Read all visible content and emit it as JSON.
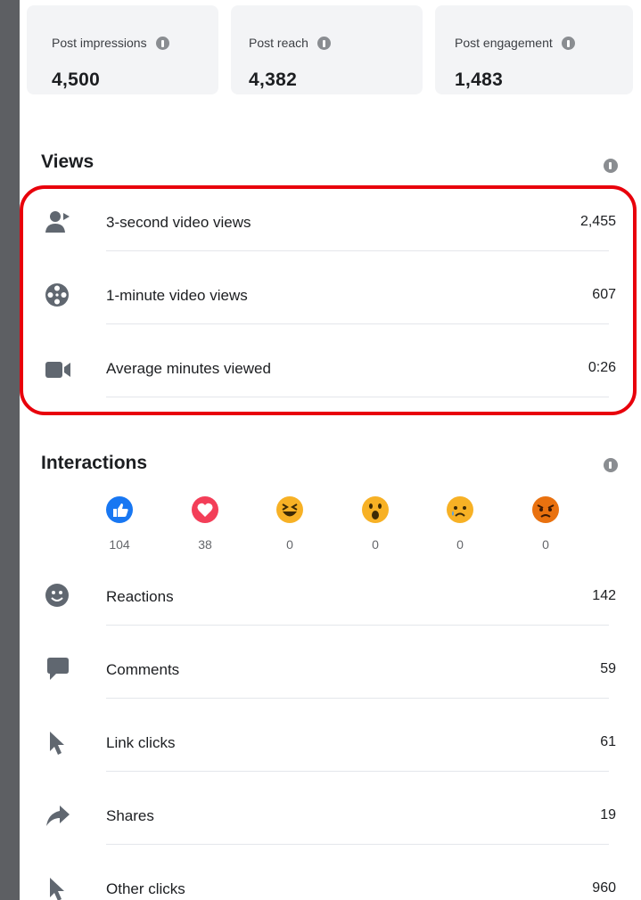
{
  "stats": [
    {
      "label": "Post impressions",
      "value": "4,500"
    },
    {
      "label": "Post reach",
      "value": "4,382"
    },
    {
      "label": "Post engagement",
      "value": "1,483"
    }
  ],
  "views": {
    "title": "Views",
    "rows": [
      {
        "label": "3-second video views",
        "value": "2,455",
        "icon": "person-video-icon"
      },
      {
        "label": "1-minute video views",
        "value": "607",
        "icon": "film-reel-icon"
      },
      {
        "label": "Average minutes viewed",
        "value": "0:26",
        "icon": "video-camera-icon"
      }
    ]
  },
  "interactions": {
    "title": "Interactions",
    "reactions": [
      {
        "name": "like",
        "count": "104",
        "color": "#1877f2"
      },
      {
        "name": "love",
        "count": "38",
        "color": "#f33e58"
      },
      {
        "name": "haha",
        "count": "0",
        "color": "#f7b125"
      },
      {
        "name": "wow",
        "count": "0",
        "color": "#f7b125"
      },
      {
        "name": "sad",
        "count": "0",
        "color": "#f7b125"
      },
      {
        "name": "angry",
        "count": "0",
        "color": "#e9710f"
      }
    ],
    "rows": [
      {
        "label": "Reactions",
        "value": "142",
        "icon": "smiley-icon"
      },
      {
        "label": "Comments",
        "value": "59",
        "icon": "comment-bubble-icon"
      },
      {
        "label": "Link clicks",
        "value": "61",
        "icon": "cursor-icon"
      },
      {
        "label": "Shares",
        "value": "19",
        "icon": "share-arrow-icon"
      },
      {
        "label": "Other clicks",
        "value": "960",
        "icon": "cursor-icon"
      }
    ]
  },
  "colors": {
    "highlight": "#e8000b",
    "icon_gray": "#606770"
  }
}
